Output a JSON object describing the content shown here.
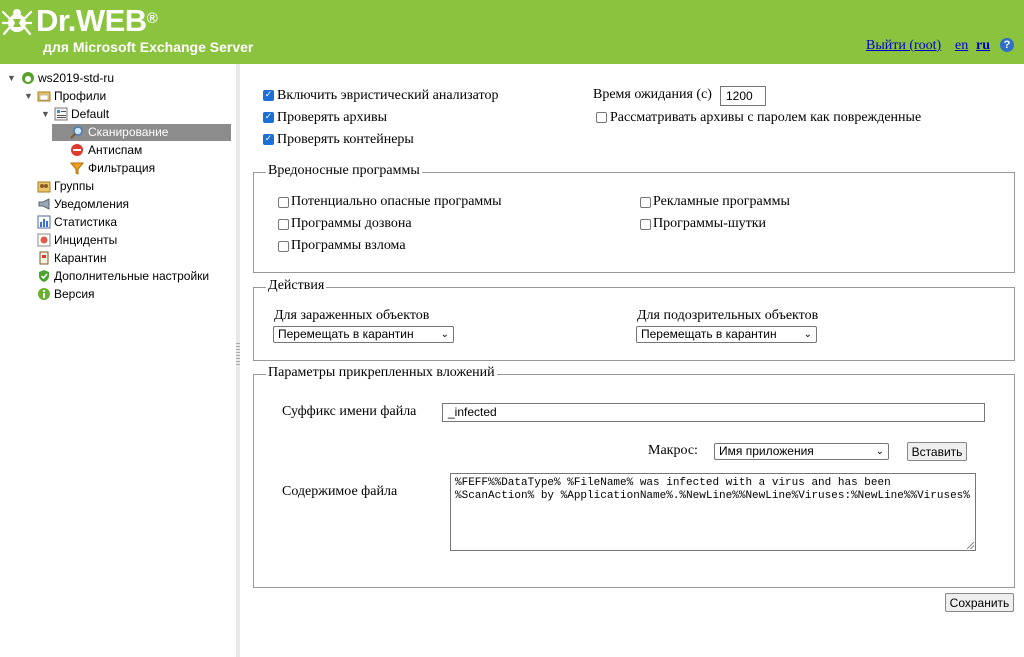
{
  "header": {
    "brand": "Dr.WEB",
    "brand_mark": "®",
    "subtitle": "для Microsoft Exchange Server",
    "logout_link": "Выйти (root)",
    "lang_en": "en",
    "lang_ru": "ru",
    "help": "?"
  },
  "sidebar": {
    "server": "ws2019-std-ru",
    "profiles": "Профили",
    "default": "Default",
    "scanning": "Сканирование",
    "antispam": "Антиспам",
    "filtering": "Фильтрация",
    "groups": "Группы",
    "notifications": "Уведомления",
    "statistics": "Статистика",
    "incidents": "Инциденты",
    "quarantine": "Карантин",
    "advanced": "Дополнительные настройки",
    "version": "Версия"
  },
  "scan": {
    "heuristic_label": "Включить эвристический анализатор",
    "heuristic_checked": true,
    "archives_label": "Проверять архивы",
    "archives_checked": true,
    "containers_label": "Проверять контейнеры",
    "containers_checked": true,
    "timeout_label": "Время ожидания (с)",
    "timeout_value": "1200",
    "password_archives_label": "Рассматривать архивы с паролем как поврежденные",
    "password_archives_checked": false
  },
  "malware": {
    "legend": "Вредоносные программы",
    "riskware": "Потенциально опасные программы",
    "dialers": "Программы дозвона",
    "hacktools": "Программы взлома",
    "adware": "Рекламные программы",
    "jokes": "Программы-шутки"
  },
  "actions": {
    "legend": "Действия",
    "infected_label": "Для зараженных объектов",
    "infected_value": "Перемещать в карантин",
    "suspicious_label": "Для подозрительных объектов",
    "suspicious_value": "Перемещать в карантин"
  },
  "attachments": {
    "legend": "Параметры прикрепленных вложений",
    "suffix_label": "Суффикс имени файла",
    "suffix_value": "_infected",
    "macro_label": "Макрос:",
    "macro_value": "Имя приложения",
    "insert_button": "Вставить",
    "content_label": "Содержимое файла",
    "content_value": "%FEFF%%DataType% %FileName% was infected with a virus and has been\n%ScanAction% by %ApplicationName%.%NewLine%%NewLine%Viruses:%NewLine%%Viruses%"
  },
  "save_button": "Сохранить",
  "colors": {
    "header_bg": "#8ac33d",
    "link": "#0000cc",
    "selected": "#8c8c8c",
    "checkbox": "#1a6fd8"
  }
}
